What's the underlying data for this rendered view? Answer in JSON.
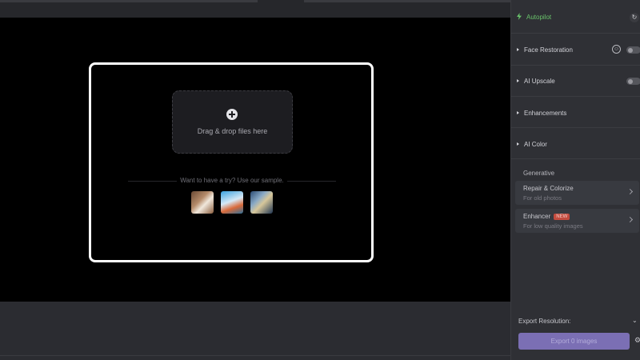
{
  "canvas": {
    "drop_text": "Drag & drop files here",
    "sample_text": "Want to have a try? Use our sample.",
    "samples": [
      {
        "icon": "portrait-woman-thumbnail"
      },
      {
        "icon": "coastal-town-thumbnail"
      },
      {
        "icon": "cartoon-character-thumbnail"
      }
    ]
  },
  "sidebar": {
    "autopilot_label": "Autopilot",
    "sections": [
      {
        "label": "Face Restoration"
      },
      {
        "label": "AI Upscale"
      },
      {
        "label": "Enhancements"
      },
      {
        "label": "AI Color"
      }
    ],
    "generative_label": "Generative",
    "cards": [
      {
        "title": "Repair & Colorize",
        "subtitle": "For old photos"
      },
      {
        "title": "Enhancer",
        "badge": "NEW",
        "subtitle": "For low quality images"
      }
    ],
    "export_resolution_label": "Export Resolution:",
    "export_button_label": "Export 0 images"
  },
  "colors": {
    "accent_green": "#69c26b",
    "export_button": "#7b6fb4",
    "new_badge": "#c34b3e"
  }
}
